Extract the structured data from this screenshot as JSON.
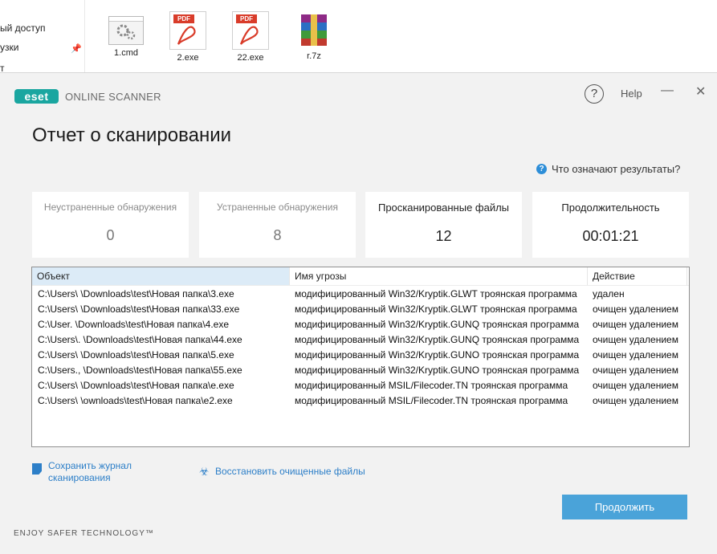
{
  "explorer": {
    "nav": [
      "ый доступ",
      "узки",
      "т"
    ],
    "files": [
      {
        "name": "1.cmd",
        "icon": "cmd-file-icon"
      },
      {
        "name": "2.exe",
        "icon": "pdf-file-icon",
        "badge": "PDF"
      },
      {
        "name": "22.exe",
        "icon": "pdf-file-icon",
        "badge": "PDF"
      },
      {
        "name": "r.7z",
        "icon": "archive-file-icon"
      }
    ]
  },
  "window": {
    "logo": "eset",
    "product": "ONLINE SCANNER",
    "help_glyph": "?",
    "help_label": "Help",
    "minimize_glyph": "—",
    "close_glyph": "✕",
    "accent": "#1aa6a0"
  },
  "title": "Отчет о сканировании",
  "results_link": "Что означают результаты?",
  "stats": [
    {
      "label": "Неустраненные обнаружения",
      "value": "0"
    },
    {
      "label": "Устраненные обнаружения",
      "value": "8"
    },
    {
      "label": "Просканированные файлы",
      "value": "12"
    },
    {
      "label": "Продолжительность",
      "value": "00:01:21"
    }
  ],
  "table": {
    "headers": [
      "Объект",
      "Имя угрозы",
      "Действие"
    ],
    "rows": [
      [
        "C:\\Users\\       \\Downloads\\test\\Новая папка\\3.exe",
        "модифицированный Win32/Kryptik.GLWT троянская программа",
        "удален"
      ],
      [
        "C:\\Users\\        \\Downloads\\test\\Новая папка\\33.exe",
        "модифицированный Win32/Kryptik.GLWT троянская программа",
        "очищен удалением"
      ],
      [
        "C:\\User.        \\Downloads\\test\\Новая папка\\4.exe",
        "модифицированный Win32/Kryptik.GUNQ троянская программа",
        "очищен удалением"
      ],
      [
        "C:\\Users\\.       \\Downloads\\test\\Новая папка\\44.exe",
        "модифицированный Win32/Kryptik.GUNQ троянская программа",
        "очищен удалением"
      ],
      [
        "C:\\Users\\        \\Downloads\\test\\Новая папка\\5.exe",
        "модифицированный Win32/Kryptik.GUNO троянская программа",
        "очищен удалением"
      ],
      [
        "C:\\Users.,       \\Downloads\\test\\Новая папка\\55.exe",
        "модифицированный Win32/Kryptik.GUNO троянская программа",
        "очищен удалением"
      ],
      [
        "C:\\Users\\        \\Downloads\\test\\Новая папка\\e.exe",
        "модифицированный MSIL/Filecoder.TN троянская программа",
        "очищен удалением"
      ],
      [
        "C:\\Users\\        \\ownloads\\test\\Новая папка\\e2.exe",
        "модифицированный MSIL/Filecoder.TN троянская программа",
        "очищен удалением"
      ]
    ]
  },
  "save_log": [
    "Сохранить журнал",
    "сканирования"
  ],
  "restore": "Восстановить очищенные файлы",
  "continue_button": "Продолжить",
  "tagline": "ENJOY SAFER TECHNOLOGY™"
}
